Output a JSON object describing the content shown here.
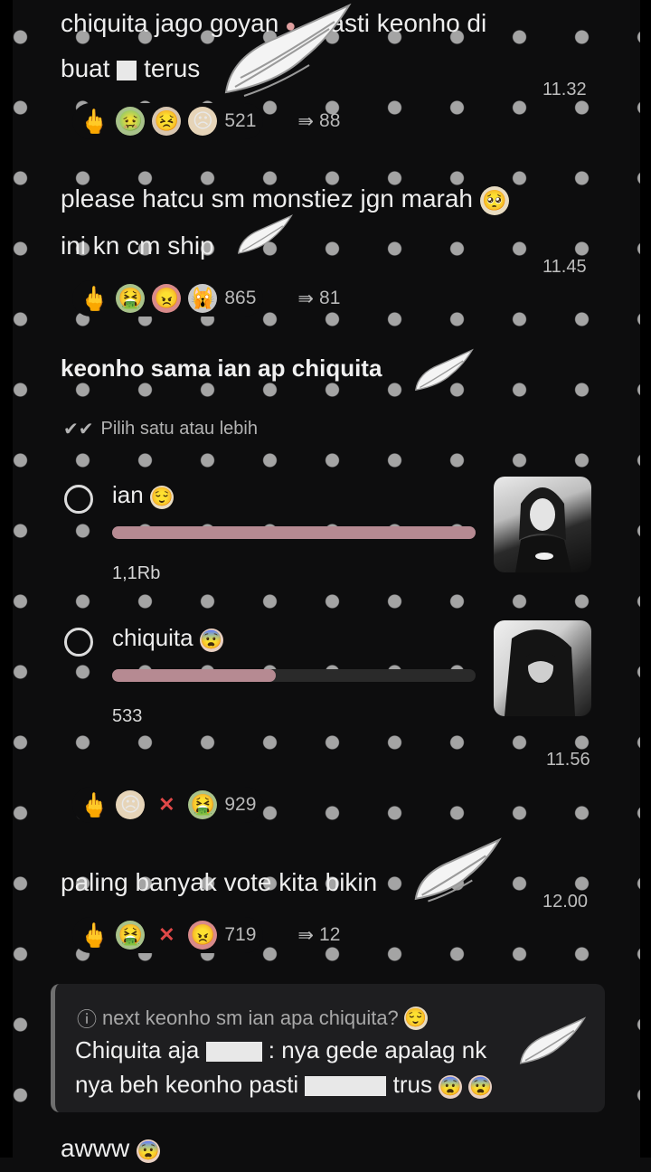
{
  "messages": [
    {
      "line1": "chiquita jago goyan",
      "line1_tail": ", pasti keonho di",
      "line2": "buat",
      "line2_tail": "terus",
      "time": "11.32",
      "reactions": [
        "middle-finger",
        "nauseated",
        "confounded",
        "frowning"
      ],
      "reaction_count": "521",
      "forward_count": "88"
    },
    {
      "line1": "please hatcu sm monstiez jgn marah",
      "line2": "ini kn cm ship",
      "time": "11.45",
      "reactions": [
        "middle-finger",
        "nauseated",
        "angry",
        "cat"
      ],
      "reaction_count": "865",
      "forward_count": "81"
    }
  ],
  "poll": {
    "question": "keonho sama ian ap chiquita",
    "subtitle": "Pilih satu atau lebih",
    "options": [
      {
        "label": "ian",
        "votes": "1,1Rb",
        "fill": 1.0
      },
      {
        "label": "chiquita",
        "votes": "533",
        "fill": 0.45
      }
    ],
    "time": "11.56",
    "reactions": [
      "middle-finger",
      "frowning",
      "cross",
      "nauseated"
    ],
    "reaction_count": "929"
  },
  "message3": {
    "text": "paling banyak vote kita bikin",
    "time": "12.00",
    "reactions": [
      "middle-finger",
      "nauseated",
      "cross",
      "angry"
    ],
    "reaction_count": "719",
    "forward_count": "12"
  },
  "quote": {
    "question": "next keonho sm ian apa chiquita?",
    "line1_a": "Chiquita aja",
    "line1_b": ": nya gede apalag",
    "line1_c": "nk",
    "line2_a": "nya beh keonho pasti",
    "line2_b": "trus"
  },
  "last_message": "awww",
  "colors": {
    "background": "#0d0d0e",
    "poll_bar": "#b68a92",
    "quote_bg": "#1e1e20"
  }
}
